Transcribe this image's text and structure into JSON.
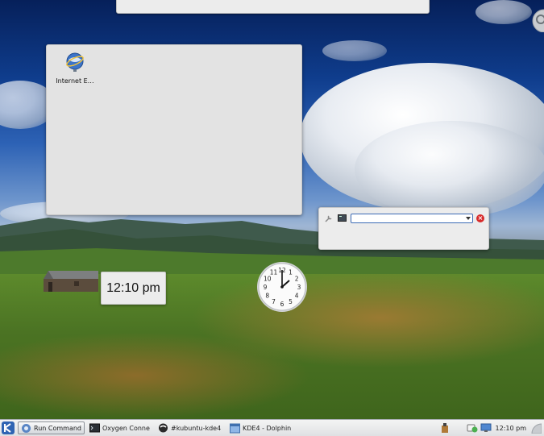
{
  "desktop": {
    "icons": [
      {
        "label": "Internet E…"
      }
    ]
  },
  "widgets": {
    "digital_clock": {
      "time": "12:10 pm"
    },
    "analog_clock": {
      "numerals": [
        "12",
        "1",
        "2",
        "3",
        "4",
        "5",
        "6",
        "7",
        "8",
        "9",
        "10",
        "11"
      ]
    },
    "runner": {
      "value": ""
    }
  },
  "taskbar": {
    "tasks": [
      {
        "label": "Run Command",
        "active": true
      },
      {
        "label": "Oxygen Conne",
        "active": false
      },
      {
        "label": "#kubuntu-kde4",
        "active": false
      },
      {
        "label": "KDE4 - Dolphin",
        "active": false
      }
    ],
    "clock": "12:10 pm"
  },
  "colors": {
    "accent": "#3c6bb5",
    "close": "#d82a2a",
    "panel": "#ececec"
  }
}
